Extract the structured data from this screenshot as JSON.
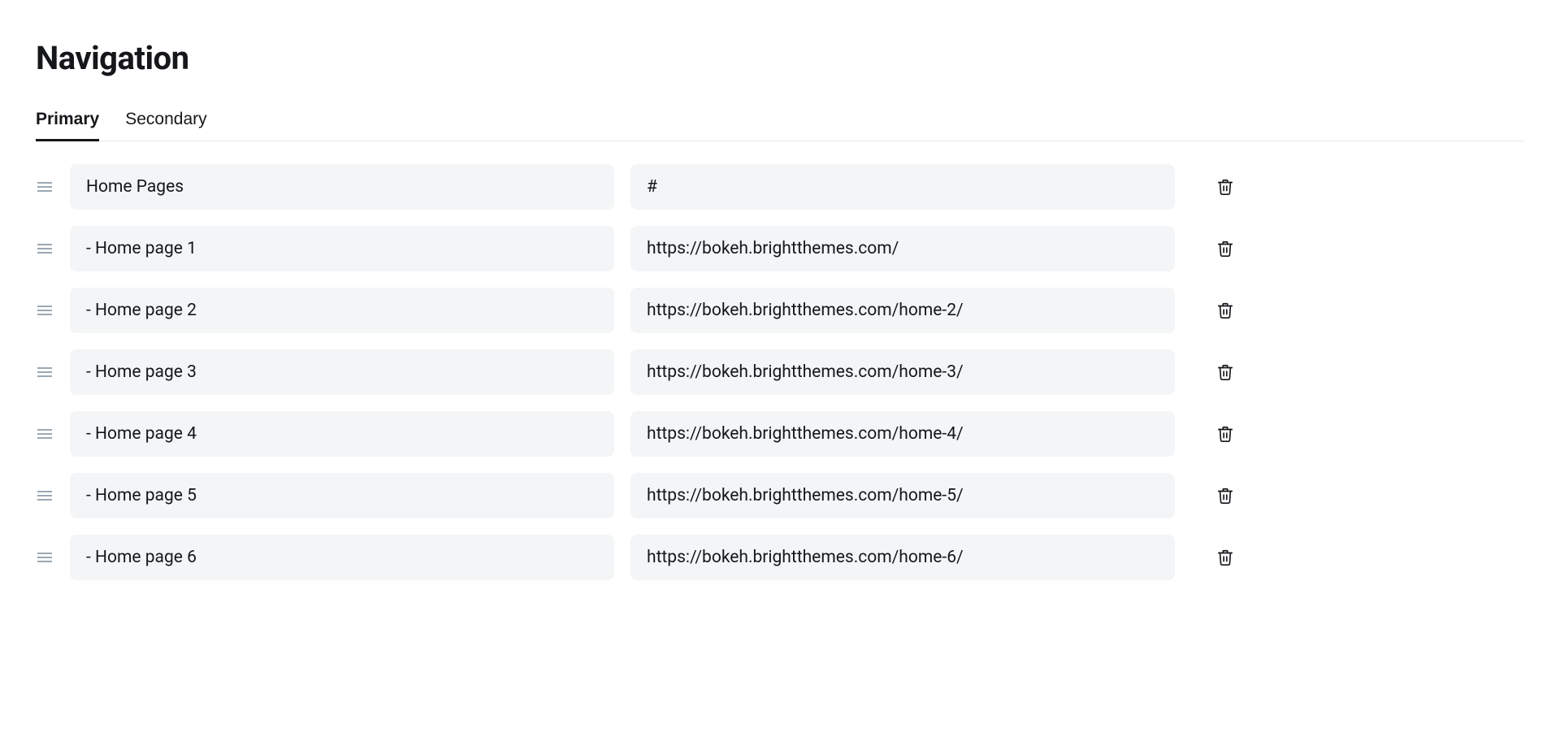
{
  "page": {
    "title": "Navigation"
  },
  "tabs": [
    {
      "label": "Primary",
      "active": true
    },
    {
      "label": "Secondary",
      "active": false
    }
  ],
  "nav_items": [
    {
      "label": "Home Pages",
      "url": "#"
    },
    {
      "label": "- Home page 1",
      "url": "https://bokeh.brightthemes.com/"
    },
    {
      "label": "- Home page 2",
      "url": "https://bokeh.brightthemes.com/home-2/"
    },
    {
      "label": "- Home page 3",
      "url": "https://bokeh.brightthemes.com/home-3/"
    },
    {
      "label": "- Home page 4",
      "url": "https://bokeh.brightthemes.com/home-4/"
    },
    {
      "label": "- Home page 5",
      "url": "https://bokeh.brightthemes.com/home-5/"
    },
    {
      "label": "- Home page 6",
      "url": "https://bokeh.brightthemes.com/home-6/"
    }
  ]
}
